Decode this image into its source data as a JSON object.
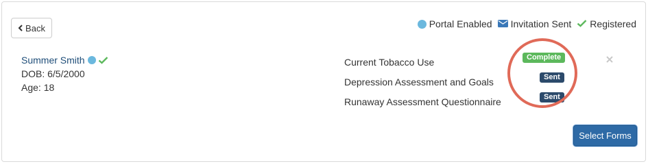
{
  "toolbar": {
    "back_label": "Back"
  },
  "legend": {
    "portal_enabled": "Portal Enabled",
    "invitation_sent": "Invitation Sent",
    "registered": "Registered"
  },
  "patient": {
    "name": "Summer Smith",
    "dob": "DOB: 6/5/2000",
    "age": "Age: 18"
  },
  "forms": [
    {
      "title": "Current Tobacco Use",
      "status": "Complete"
    },
    {
      "title": "Depression Assessment and Goals",
      "status": "Sent"
    },
    {
      "title": "Runaway Assessment Questionnaire",
      "status": "Sent"
    }
  ],
  "actions": {
    "select_forms_label": "Select Forms"
  },
  "icons": {
    "back": "chevron-left-icon",
    "portal": "circle-icon",
    "invitation": "envelope-icon",
    "registered": "check-icon",
    "remove": "close-icon"
  },
  "colors": {
    "portal_dot": "#6bb8de",
    "check": "#5cb85c",
    "envelope": "#3a78b8",
    "complete_badge": "#5cb85c",
    "sent_badge": "#2c4a6b",
    "primary_button": "#2e6aa6",
    "highlight_ring": "#e06a58"
  }
}
